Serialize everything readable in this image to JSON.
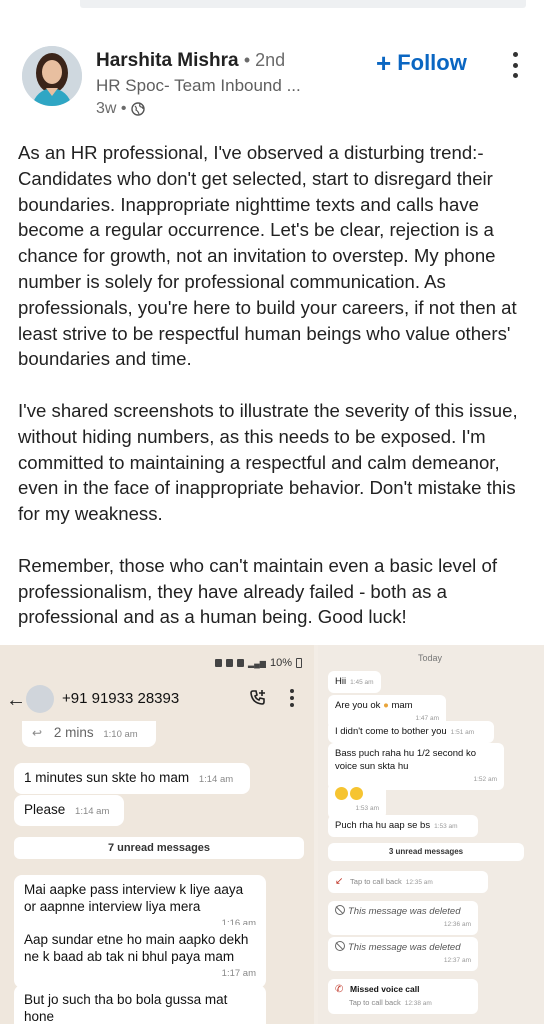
{
  "post": {
    "author_name": "Harshita Mishra",
    "connection_degree": "• 2nd",
    "headline": "HR Spoc- Team Inbound ...",
    "time_ago": "3w •",
    "follow_label": "Follow",
    "follow_icon": "plus-icon",
    "more_icon": "vertical-dots-icon",
    "paragraphs": [
      "As an HR professional, I've observed a disturbing trend:- Candidates who don't get selected, start to disregard their boundaries. Inappropriate nighttime texts and calls have become a regular occurrence. Let's be clear, rejection is a chance for growth, not an invitation to overstep. My phone number is solely for professional communication. As professionals, you're here to build your careers, if not then at least strive to be respectful human beings who value others' boundaries and time.",
      "I've shared screenshots to illustrate the severity of this issue, without hiding numbers, as this needs to be exposed. I'm committed to maintaining a respectful and calm demeanor, even in the face of inappropriate behavior. Don't mistake this for my weakness.",
      "Remember, those who can't maintain even a basic level of professionalism, they have already failed - both as a professional and as a human being. Good luck!"
    ]
  },
  "left_shot": {
    "status_text": "10%",
    "contact": "+91 91933 28393",
    "messages": [
      {
        "text": "2 mins",
        "time": "1:10 am"
      },
      {
        "text": "1 minutes sun skte ho mam",
        "time": "1:14 am"
      },
      {
        "text": "Please",
        "time": "1:14 am"
      },
      {
        "text": "Mai aapke pass interview k liye aaya or aapnne interview liya mera",
        "time": "1:16 am"
      },
      {
        "text": "Aap sundar etne ho main aapko dekh ne k baad ab tak ni bhul paya mam",
        "time": "1:17 am"
      },
      {
        "text": "But jo such tha bo bola gussa mat hone",
        "time": ""
      }
    ],
    "unread_label": "7 unread messages"
  },
  "right_shot": {
    "date_label": "Today",
    "messages": [
      {
        "text": "Hii",
        "time": "1:45 am"
      },
      {
        "text": "Are you ok",
        "emoji_after": "mam",
        "time": "1:47 am"
      },
      {
        "text": "I didn't come to bother you",
        "time": "1:51 am"
      },
      {
        "text": "Bass puch raha hu 1/2 second ko voice sun skta hu",
        "time": "1:52 am"
      },
      {
        "text": "",
        "time": "1:53 am"
      },
      {
        "text": "Puch rha hu aap se bs",
        "time": "1:53 am"
      }
    ],
    "unread_label": "3 unread messages",
    "call_back": {
      "text": "Tap to call back",
      "time": "12:35 am"
    },
    "deleted_1": {
      "text": "This message was deleted",
      "time": "12:36 am"
    },
    "deleted_2": {
      "text": "This message was deleted",
      "time": "12:37 am"
    },
    "missed_call": {
      "title": "Missed voice call",
      "sub": "Tap to call back",
      "time": "12:38 am"
    }
  },
  "colors": {
    "follow_blue": "#0a66c2",
    "chat_bg": "#efe7dd",
    "missed_call_red": "#c0392b"
  }
}
